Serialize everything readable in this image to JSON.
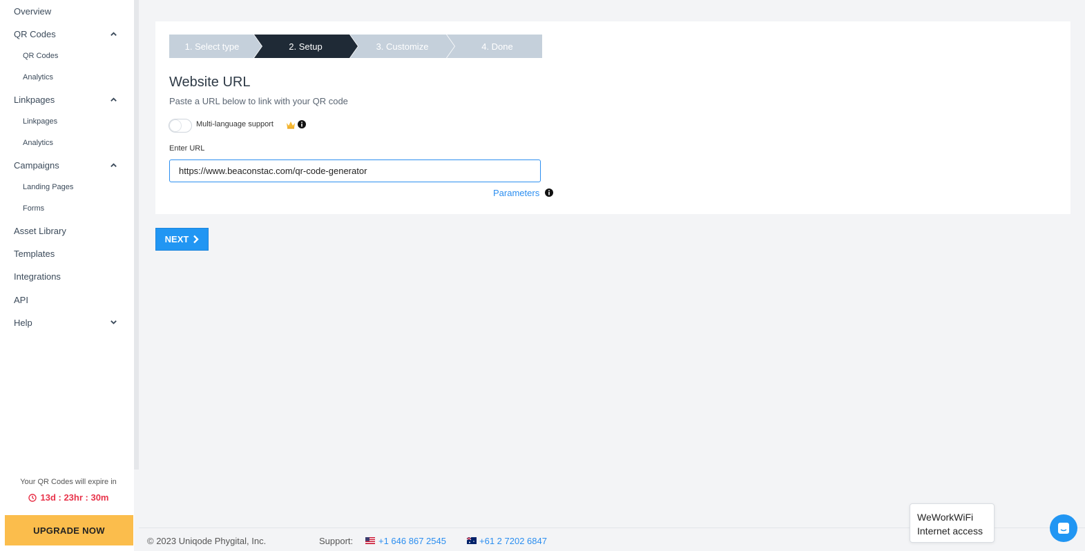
{
  "sidebar": {
    "items": [
      {
        "label": "Overview"
      },
      {
        "label": "QR Codes",
        "children": [
          "QR Codes",
          "Analytics"
        ]
      },
      {
        "label": "Linkpages",
        "children": [
          "Linkpages",
          "Analytics"
        ]
      },
      {
        "label": "Campaigns",
        "children": [
          "Landing Pages",
          "Forms"
        ]
      },
      {
        "label": "Asset Library"
      },
      {
        "label": "Templates"
      },
      {
        "label": "Integrations"
      },
      {
        "label": "API"
      },
      {
        "label": "Help"
      }
    ],
    "expire_text": "Your QR Codes will expire in",
    "expire_timer": "13d : 23hr : 30m",
    "upgrade_label": "UPGRADE NOW"
  },
  "wizard": {
    "steps": [
      "1. Select type",
      "2. Setup",
      "3. Customize",
      "4. Done"
    ],
    "active_step": 2,
    "title": "Website URL",
    "subtitle": "Paste a URL below to link with your QR code",
    "multi_language_label": "Multi-language support",
    "multi_language_enabled": false,
    "url_label": "Enter URL",
    "url_value": "https://www.beaconstac.com/qr-code-generator",
    "parameters_label": "Parameters",
    "next_label": "NEXT"
  },
  "footer": {
    "copyright": "© 2023 Uniqode Phygital, Inc.",
    "support_label": "Support:",
    "phone_us": "+1 646 867 2545",
    "phone_au": "+61 2 7202 6847"
  },
  "wifi_popup": {
    "line1": "WeWorkWiFi",
    "line2": "Internet access"
  },
  "colors": {
    "accent": "#2196f3",
    "step_active": "#1f2a36",
    "step_inactive": "#c5d0db",
    "upgrade": "#fbbd4c",
    "timer": "#e8334a"
  }
}
